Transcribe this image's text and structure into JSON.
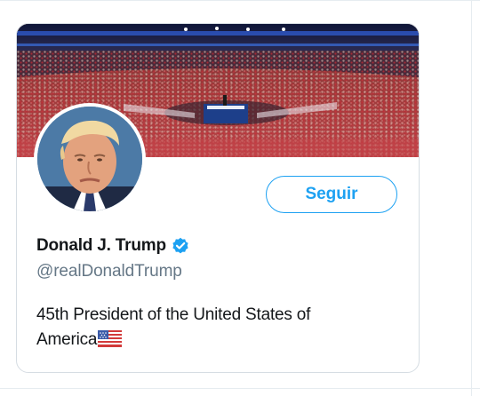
{
  "profile": {
    "display_name": "Donald J. Trump",
    "handle": "@realDonaldTrump",
    "bio_line1": "45th President of the United States of",
    "bio_line2": "America",
    "follow_label": "Seguir",
    "verified": true
  },
  "icons": {
    "verified": "verified-badge-icon",
    "flag": "us-flag-icon"
  },
  "colors": {
    "accent": "#1da1f2",
    "name_text": "#14171a",
    "handle_text": "#657786",
    "card_border": "#d6dde3"
  }
}
